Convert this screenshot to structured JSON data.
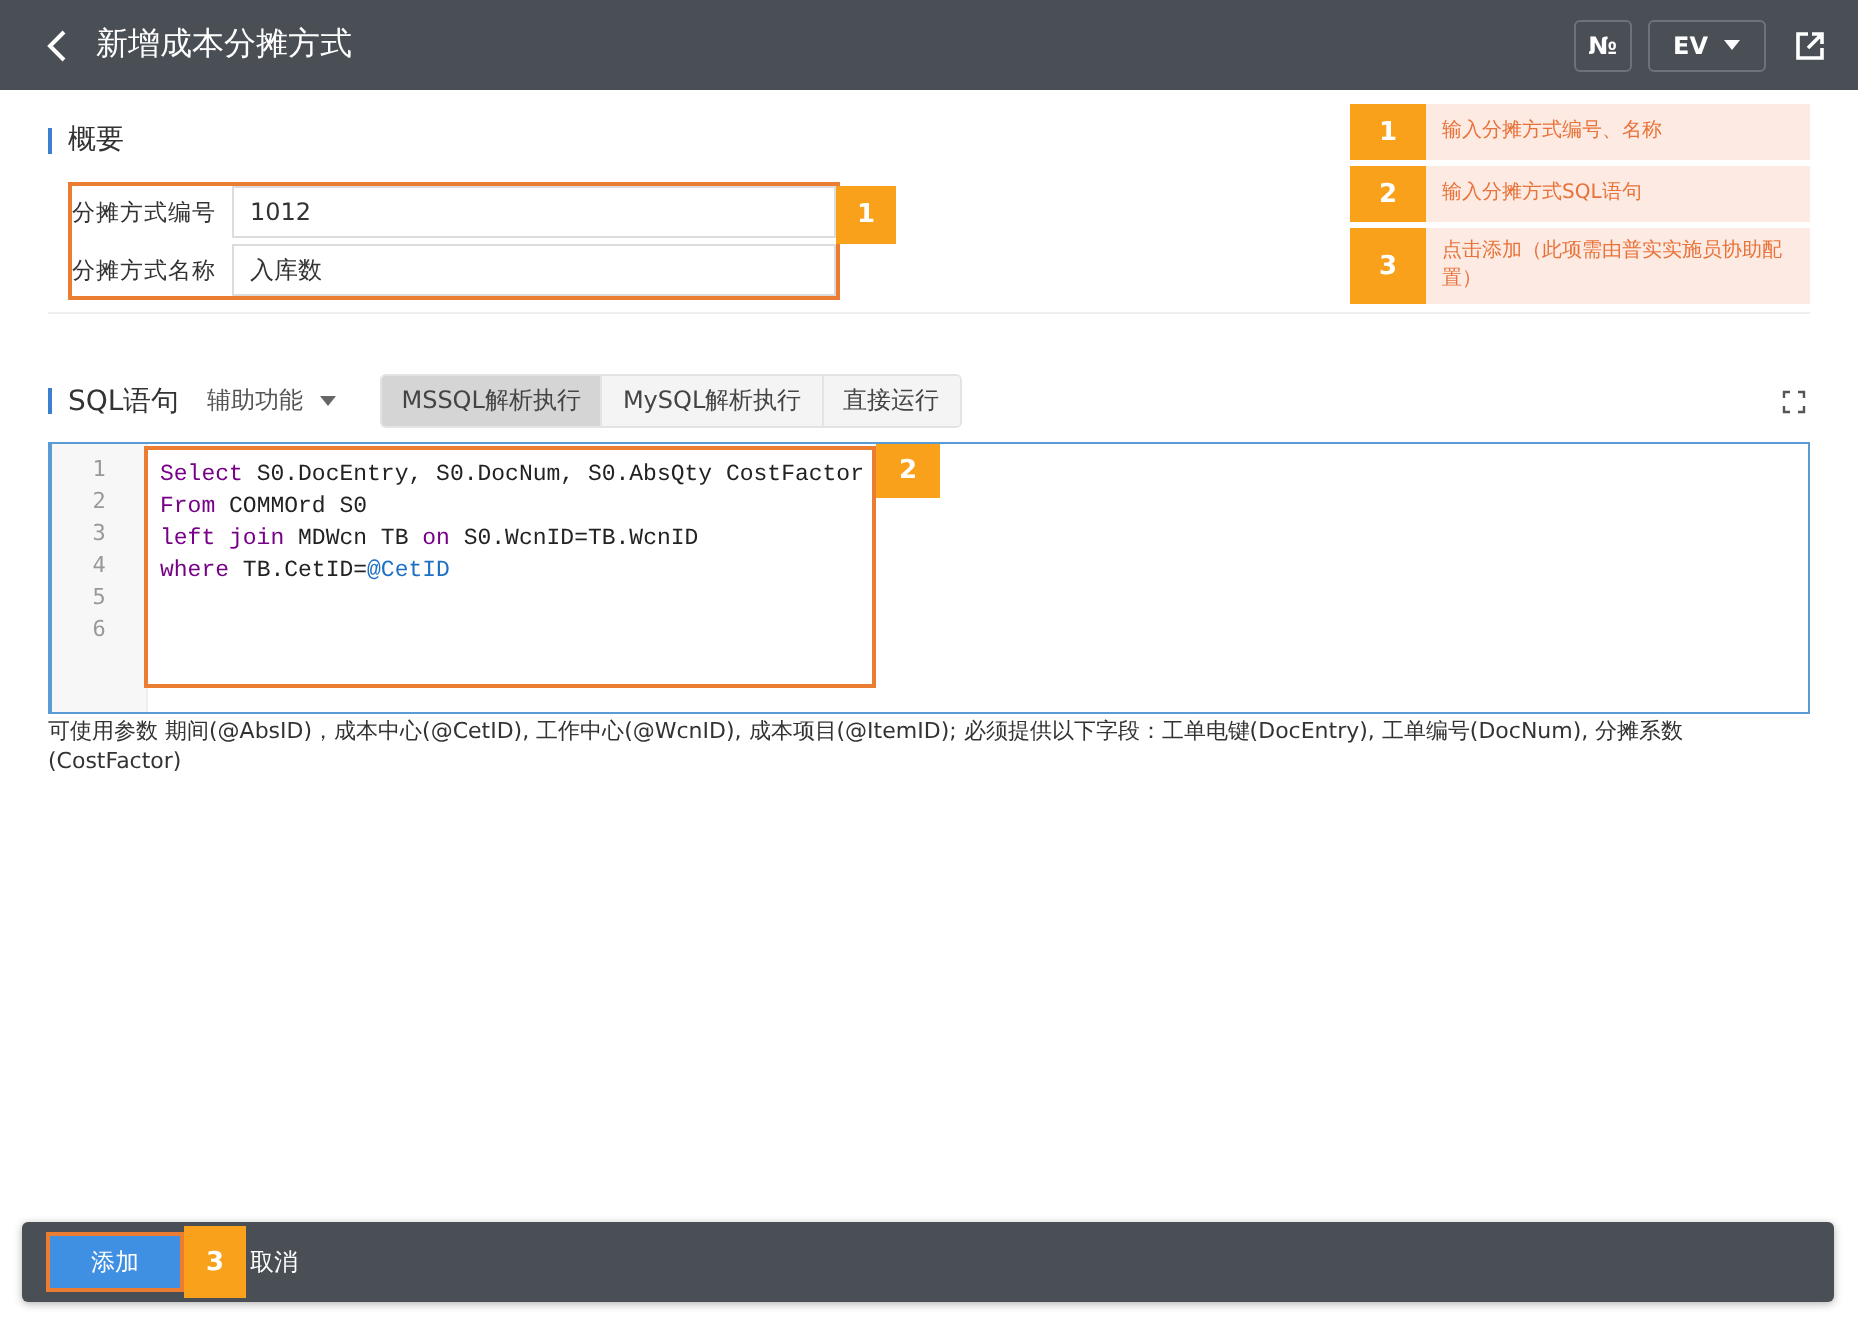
{
  "header": {
    "title": "新增成本分摊方式",
    "buttons": [
      {
        "kind": "number",
        "label": "№"
      },
      {
        "kind": "dropdown",
        "label": "EV"
      }
    ]
  },
  "guide": [
    {
      "number": "1",
      "text": "输入分摊方式编号、名称"
    },
    {
      "number": "2",
      "text": "输入分摊方式SQL语句"
    },
    {
      "number": "3",
      "text": "点击添加（此项需由普实实施员协助配置）"
    }
  ],
  "overview": {
    "heading": "概要",
    "callout": "1",
    "fields": [
      {
        "label": "分摊方式编号",
        "value": "1012"
      },
      {
        "label": "分摊方式名称",
        "value": "入库数"
      }
    ]
  },
  "sql": {
    "heading": "SQL语句",
    "assist": "辅助功能",
    "callout": "2",
    "modes": [
      {
        "label": "MSSQL解析执行",
        "selected": true
      },
      {
        "label": "MySQL解析执行",
        "selected": false
      },
      {
        "label": "直接运行",
        "selected": false
      }
    ],
    "lines": [
      {
        "number": "1",
        "tokens": [
          {
            "kind": "keyword",
            "text": "Select"
          },
          {
            "kind": "plain",
            "text": " S0.DocEntry, S0.DocNum, S0.AbsQty CostFactor"
          }
        ]
      },
      {
        "number": "2",
        "tokens": [
          {
            "kind": "keyword",
            "text": "From"
          },
          {
            "kind": "plain",
            "text": " COMMOrd S0"
          }
        ]
      },
      {
        "number": "3",
        "tokens": [
          {
            "kind": "keyword",
            "text": "left join"
          },
          {
            "kind": "plain",
            "text": " MDWcn TB "
          },
          {
            "kind": "keyword",
            "text": "on"
          },
          {
            "kind": "plain",
            "text": " S0.WcnID=TB.WcnID"
          }
        ]
      },
      {
        "number": "4",
        "tokens": [
          {
            "kind": "keyword",
            "text": "where"
          },
          {
            "kind": "plain",
            "text": " TB.CetID="
          },
          {
            "kind": "variable",
            "text": "@CetID"
          }
        ]
      },
      {
        "number": "5"
      },
      {
        "number": "6"
      }
    ],
    "hint": "可使用参数 期间(@AbsID)，成本中心(@CetID), 工作中心(@WcnID), 成本项目(@ItemID); 必须提供以下字段：工单电键(DocEntry), 工单编号(DocNum), 分摊系数(CostFactor)"
  },
  "footer": {
    "callout": "3",
    "buttons": [
      {
        "kind": "primary",
        "label": "添加"
      },
      {
        "kind": "plain",
        "label": "取消"
      }
    ]
  }
}
